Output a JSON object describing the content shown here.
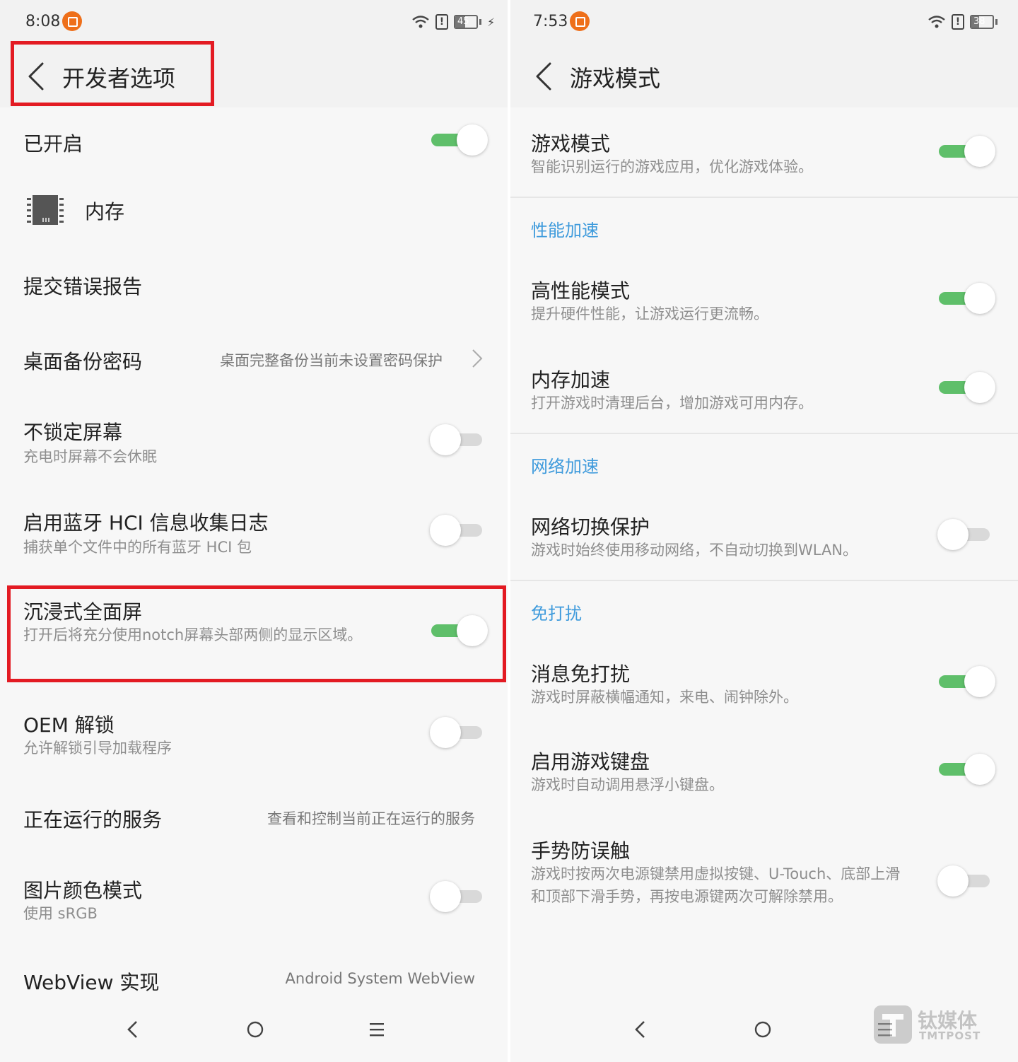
{
  "left": {
    "status": {
      "time": "8:08",
      "battery": "45",
      "battery_level_pct": 45,
      "alert": "!"
    },
    "header": {
      "title": "开发者选项"
    },
    "rows": {
      "enabled": {
        "title": "已开启"
      },
      "memory": {
        "title": "内存"
      },
      "bug_report": {
        "title": "提交错误报告"
      },
      "backup_password": {
        "title": "桌面备份密码",
        "value": "桌面完整备份当前未设置密码保护"
      },
      "stay_awake": {
        "title": "不锁定屏幕",
        "subtitle": "充电时屏幕不会休眠"
      },
      "bt_hci": {
        "title": "启用蓝牙 HCI 信息收集日志",
        "subtitle": "捕获单个文件中的所有蓝牙 HCI 包"
      },
      "immersive": {
        "title": "沉浸式全面屏",
        "subtitle": "打开后将充分使用notch屏幕头部两侧的显示区域。"
      },
      "oem_unlock": {
        "title": "OEM 解锁",
        "subtitle": "允许解锁引导加载程序"
      },
      "running_services": {
        "title": "正在运行的服务",
        "value": "查看和控制当前正在运行的服务"
      },
      "color_mode": {
        "title": "图片颜色模式",
        "subtitle": "使用 sRGB"
      },
      "webview": {
        "title": "WebView 实现",
        "value": "Android System WebView"
      }
    },
    "toggles": {
      "enabled": true,
      "stay_awake": false,
      "bt_hci": false,
      "immersive": true,
      "oem_unlock": false,
      "color_mode": false
    }
  },
  "right": {
    "status": {
      "time": "7:53",
      "battery": "38",
      "battery_level_pct": 38,
      "alert": "!"
    },
    "header": {
      "title": "游戏模式"
    },
    "rows": {
      "game_mode": {
        "title": "游戏模式",
        "subtitle": "智能识别运行的游戏应用，优化游戏体验。"
      },
      "high_perf": {
        "title": "高性能模式",
        "subtitle": "提升硬件性能，让游戏运行更流畅。"
      },
      "mem_boost": {
        "title": "内存加速",
        "subtitle": "打开游戏时清理后台，增加游戏可用内存。"
      },
      "net_protect": {
        "title": "网络切换保护",
        "subtitle": "游戏时始终使用移动网络，不自动切换到WLAN。"
      },
      "msg_dnd": {
        "title": "消息免打扰",
        "subtitle": "游戏时屏蔽横幅通知，来电、闹钟除外。"
      },
      "game_keyboard": {
        "title": "启用游戏键盘",
        "subtitle": "游戏时自动调用悬浮小键盘。"
      },
      "gesture_guard": {
        "title": "手势防误触",
        "subtitle": "游戏时按两次电源键禁用虚拟按键、U-Touch、底部上滑和顶部下滑手势，再按电源键两次可解除禁用。"
      }
    },
    "sections": {
      "performance": "性能加速",
      "network": "网络加速",
      "dnd": "免打扰"
    },
    "toggles": {
      "game_mode": true,
      "high_perf": true,
      "mem_boost": true,
      "net_protect": false,
      "msg_dnd": true,
      "game_keyboard": true,
      "gesture_guard": false
    }
  },
  "watermark": {
    "cn": "钛媒体",
    "en": "TMTPOST"
  },
  "colors": {
    "accent_blue": "#3f9bdc",
    "toggle_on": "#5fbf6a",
    "highlight_red": "#e31b23",
    "notification_orange": "#ee6f1a"
  }
}
